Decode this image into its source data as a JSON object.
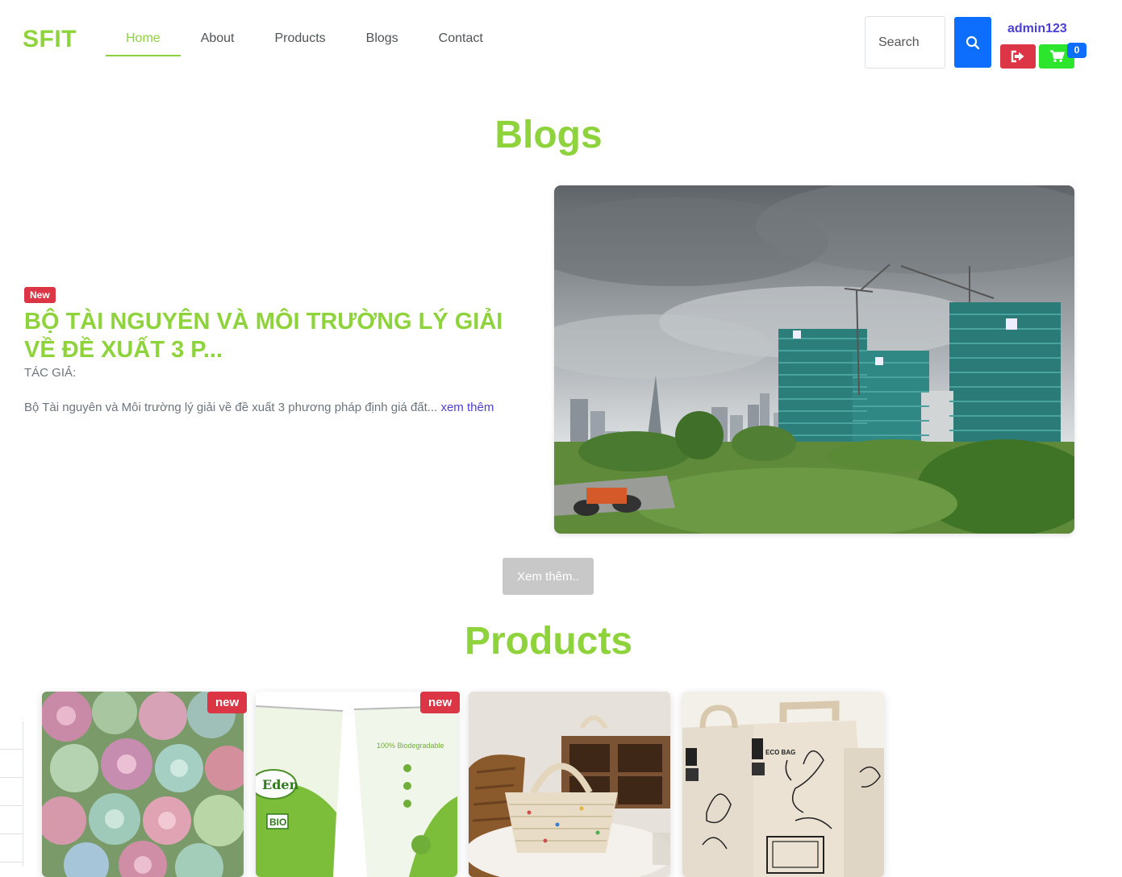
{
  "header": {
    "logo": "SFIT",
    "nav": [
      {
        "label": "Home",
        "active": true
      },
      {
        "label": "About"
      },
      {
        "label": "Products"
      },
      {
        "label": "Blogs"
      },
      {
        "label": "Contact"
      }
    ],
    "search_placeholder": "Search",
    "username": "admin123",
    "cart_count": "0"
  },
  "colors": {
    "brand_green": "#8fd33c",
    "primary_blue": "#0d6efd",
    "danger_red": "#dc3545",
    "cart_green": "#2ee52e",
    "link_purple": "#4a3fd6"
  },
  "icons": {
    "search": "search-icon",
    "logout": "sign-out-icon",
    "cart": "shopping-cart-icon"
  },
  "blogs_section": {
    "title": "Blogs",
    "featured": {
      "badge": "New",
      "title": "BỘ TÀI NGUYÊN VÀ MÔI TRƯỜNG LÝ GIẢI VỀ ĐỀ XUẤT 3 P...",
      "author_label": "TÁC GIẢ:",
      "excerpt": "Bộ Tài nguyên và Môi trường lý giải về đề xuất 3 phương pháp định giá đất...",
      "read_more": "xem thêm"
    },
    "more_button": "Xem thêm.."
  },
  "products_section": {
    "title": "Products",
    "badges": [
      "new",
      "new"
    ],
    "items": [
      {
        "image": "succulent-plants"
      },
      {
        "image": "eden-biodegradable-paper-cups",
        "cup_text": [
          "Eden",
          "100% Biodegradable",
          "BIO"
        ]
      },
      {
        "image": "woven-rope-basket-bag"
      },
      {
        "image": "kraft-paper-bags",
        "bag_text": "ECO BAG"
      }
    ]
  }
}
